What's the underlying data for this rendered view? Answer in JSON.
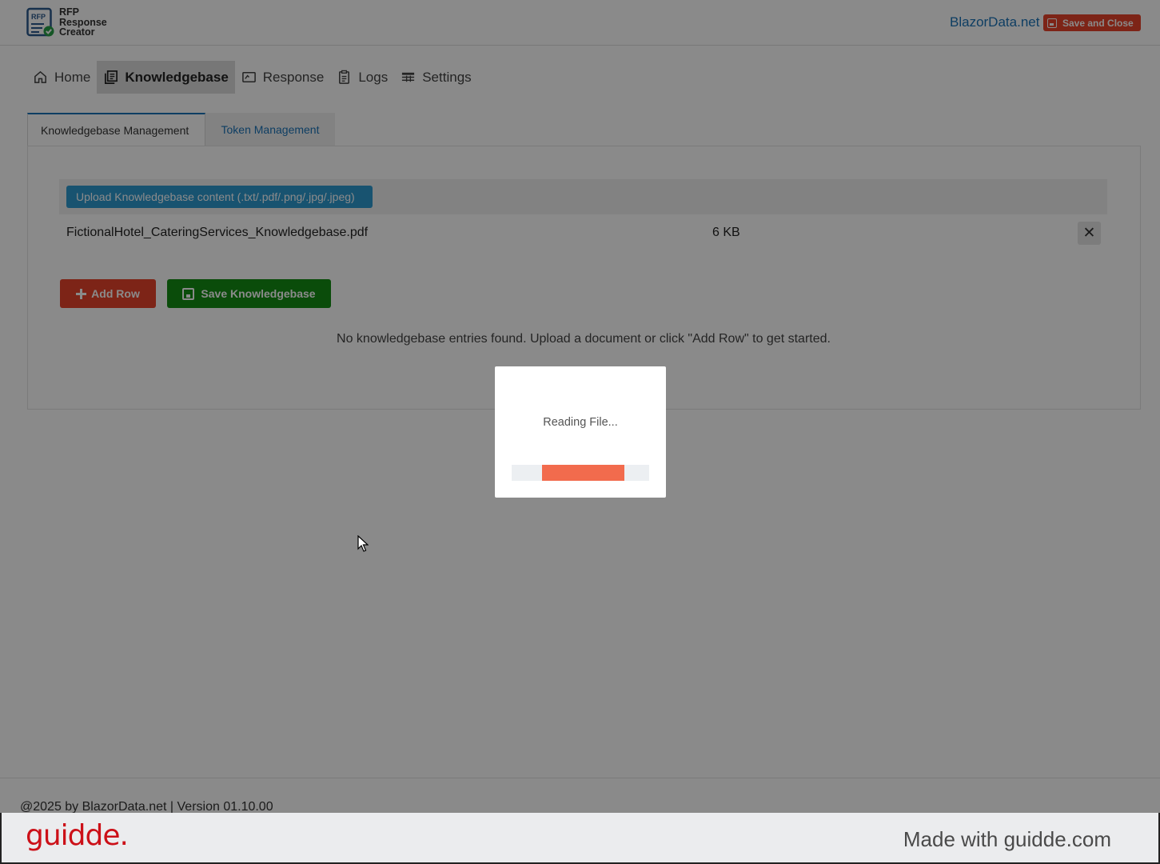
{
  "header": {
    "logo_lines": [
      "RFP",
      "Response",
      "Creator"
    ],
    "logo_badge": "RFP",
    "brand_link": "BlazorData.net",
    "save_close_label": "Save and Close"
  },
  "nav": {
    "items": [
      {
        "label": "Home",
        "icon": "home-icon"
      },
      {
        "label": "Knowledgebase",
        "icon": "knowledgebase-icon",
        "active": true
      },
      {
        "label": "Response",
        "icon": "response-icon"
      },
      {
        "label": "Logs",
        "icon": "logs-icon"
      },
      {
        "label": "Settings",
        "icon": "settings-icon"
      }
    ]
  },
  "tabs": {
    "active": "Knowledgebase Management",
    "inactive": "Token Management"
  },
  "upload": {
    "button_label": "Upload Knowledgebase content (.txt/.pdf/.png/.jpg/.jpeg)"
  },
  "files": [
    {
      "name": "FictionalHotel_CateringServices_Knowledgebase.pdf",
      "size": "6 KB",
      "remove": "✕"
    }
  ],
  "actions": {
    "add_row": "Add Row",
    "save_knowledgebase": "Save Knowledgebase"
  },
  "empty_message": "No knowledgebase entries found. Upload a document or click \"Add Row\" to get started.",
  "footer": "@2025 by BlazorData.net | Version 01.10.00",
  "modal": {
    "text": "Reading File...",
    "progress_start": 0.22,
    "progress_end": 0.82
  },
  "guidde": {
    "logo": "guidde.",
    "made_with": "Made with guidde.com"
  },
  "colors": {
    "accent_red": "#e8442c",
    "link_blue": "#1a73b8",
    "upload_blue": "#2e9ad0",
    "save_green": "#148c14",
    "progress": "#f26b4d",
    "guidde_red": "#cc1018"
  }
}
